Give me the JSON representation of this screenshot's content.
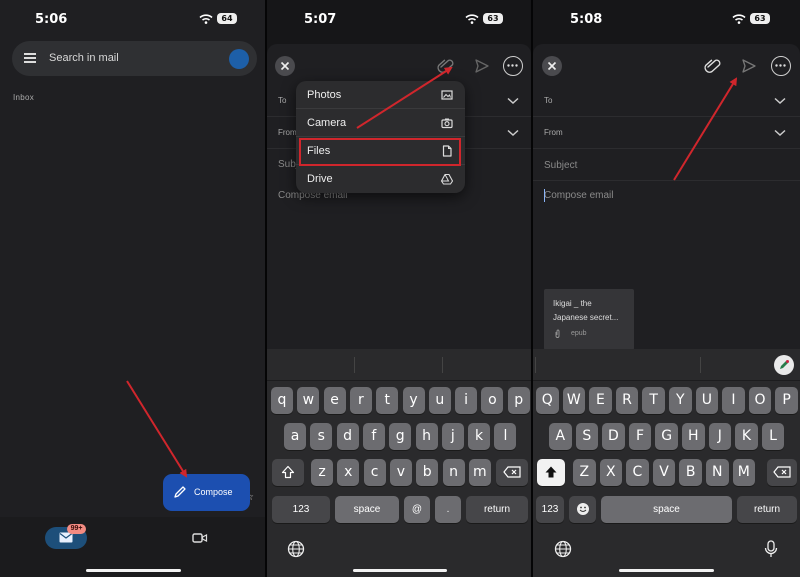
{
  "screens": [
    {
      "time": "5:06",
      "battery": "64",
      "search_placeholder": "Search in mail",
      "inbox_label": "Inbox",
      "compose_label": "Compose",
      "mail_badge": "99+"
    },
    {
      "time": "5:07",
      "battery": "63",
      "to_label": "To",
      "from_label": "From",
      "subject_placeholder": "Subject",
      "compose_placeholder": "Compose email",
      "attach_menu": [
        {
          "label": "Photos",
          "icon": "photos-icon"
        },
        {
          "label": "Camera",
          "icon": "camera-icon"
        },
        {
          "label": "Files",
          "icon": "file-icon"
        },
        {
          "label": "Drive",
          "icon": "drive-icon"
        }
      ],
      "keyboard": {
        "row1": [
          "q",
          "w",
          "e",
          "r",
          "t",
          "y",
          "u",
          "i",
          "o",
          "p"
        ],
        "row2": [
          "a",
          "s",
          "d",
          "f",
          "g",
          "h",
          "j",
          "k",
          "l"
        ],
        "row3": [
          "z",
          "x",
          "c",
          "v",
          "b",
          "n",
          "m"
        ],
        "num_label": "123",
        "space_label": "space",
        "at_label": "@",
        "dot_label": ".",
        "return_label": "return"
      }
    },
    {
      "time": "5:08",
      "battery": "63",
      "to_label": "To",
      "from_label": "From",
      "subject_placeholder": "Subject",
      "compose_placeholder": "Compose email",
      "attachment": {
        "name_line1": "Ikigai _ the",
        "name_line2": "Japanese secret...",
        "ext": "epub"
      },
      "keyboard": {
        "row1": [
          "Q",
          "W",
          "E",
          "R",
          "T",
          "Y",
          "U",
          "I",
          "O",
          "P"
        ],
        "row2": [
          "A",
          "S",
          "D",
          "F",
          "G",
          "H",
          "J",
          "K",
          "L"
        ],
        "row3": [
          "Z",
          "X",
          "C",
          "V",
          "B",
          "N",
          "M"
        ],
        "num_label": "123",
        "space_label": "space",
        "return_label": "return"
      }
    }
  ],
  "colors": {
    "annotation_red": "#d0262c",
    "compose_blue": "#1c4fb0"
  }
}
